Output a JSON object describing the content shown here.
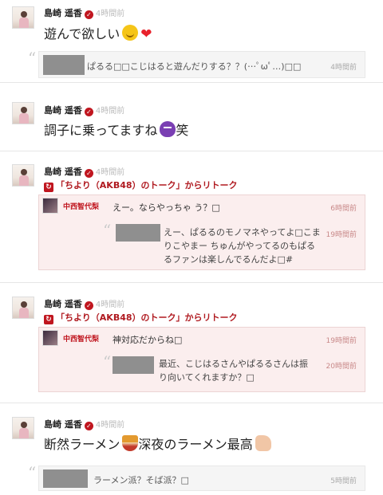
{
  "posts": [
    {
      "author": "島崎 遥香",
      "time": "4時間前",
      "message": "遊んで欲しい",
      "emojis": [
        "smile-emoji",
        "heart-emoji"
      ],
      "quote": {
        "text": "ぱるる□□こじはると遊んだりする？？(…ﾟωﾟ…)□□",
        "time": "4時間前"
      }
    },
    {
      "author": "島崎 遥香",
      "time": "4時間前",
      "message": "調子に乗ってますね",
      "suffix": "笑",
      "emojis": [
        "devil-emoji"
      ]
    },
    {
      "author": "島崎 遥香",
      "time": "4時間前",
      "retalk": "「ちより（AKB48）のトーク」からリトーク",
      "rt": {
        "name": "中西智代梨",
        "text": "えー。ならやっちゃ う？□",
        "time": "6時間前",
        "inner_text": "えー、ぱるるのモノマネやってよ□こまりこやまー ちゅんがやってるのもぱるるファンは楽しんでるんだよ□#",
        "inner_time": "19時間前"
      }
    },
    {
      "author": "島崎 遥香",
      "time": "4時間前",
      "retalk": "「ちより（AKB48）のトーク」からリトーク",
      "rt": {
        "name": "中西智代梨",
        "text": "神対応だからね□",
        "time": "19時間前",
        "inner_text": "最近、こじはるさんやぱるるさんは振り向いてくれますか？□",
        "inner_time": "20時間前"
      }
    },
    {
      "author": "島崎 遥香",
      "time": "4時間前",
      "message": "断然ラーメン",
      "message2": "深夜のラーメン最高",
      "emojis": [
        "ramen-bowl-emoji",
        "thumbs-up-emoji"
      ],
      "quote": {
        "text": "ラーメン派？そば派？□",
        "time": "5時間前"
      }
    }
  ],
  "colors": {
    "accent": "#c0161f",
    "rt_bg": "#fbeeee",
    "quote_bg": "#f5f5f5"
  }
}
